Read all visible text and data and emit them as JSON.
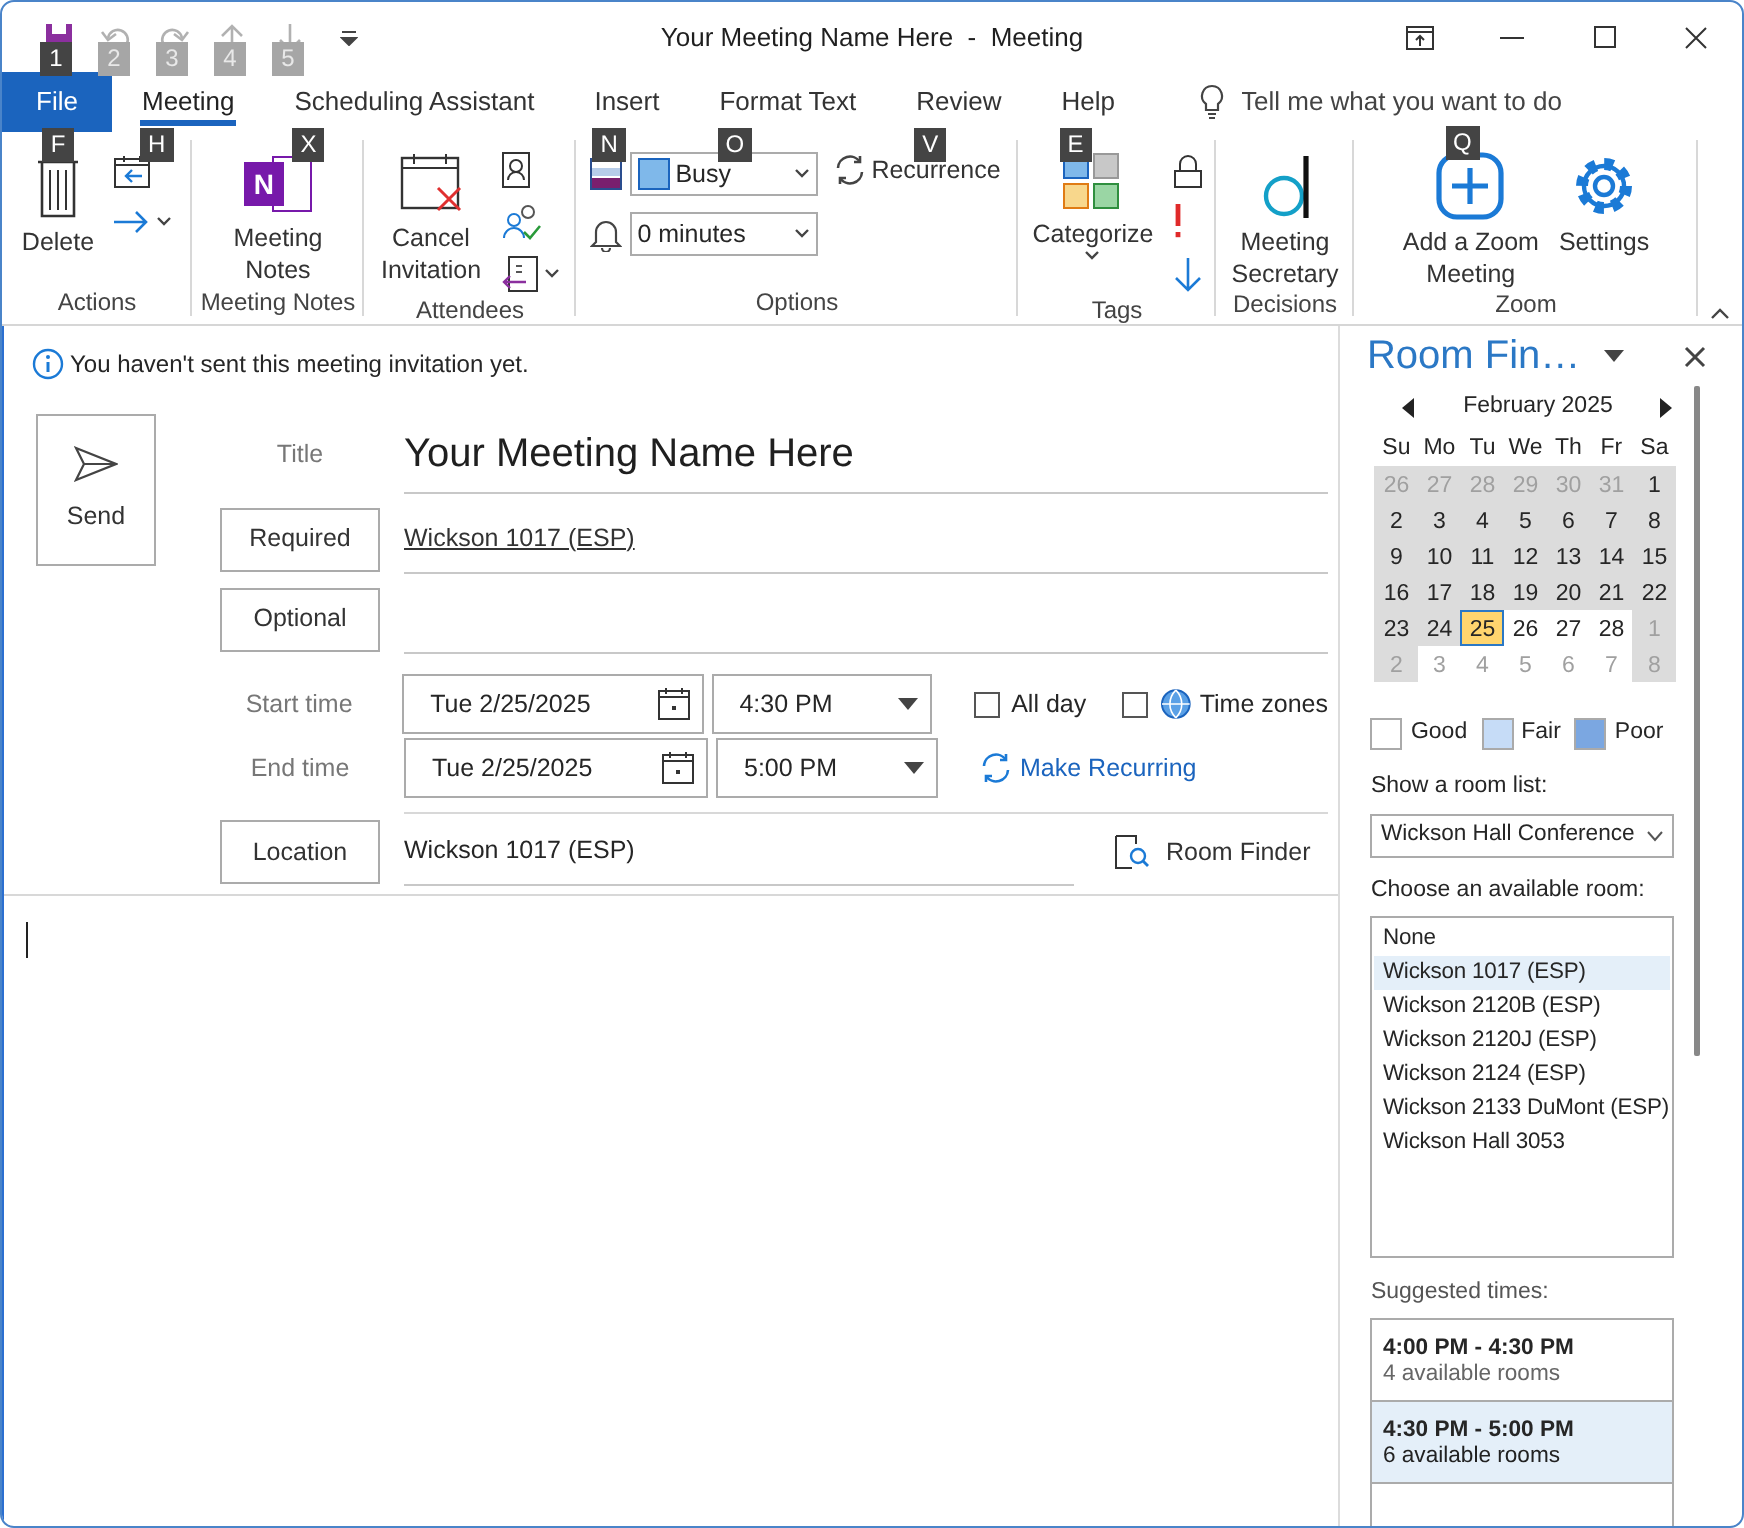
{
  "window": {
    "title": "Your Meeting Name Here  -  Meeting"
  },
  "quick_access": [
    {
      "keytip": "1",
      "disabled": false
    },
    {
      "keytip": "2",
      "disabled": true
    },
    {
      "keytip": "3",
      "disabled": true
    },
    {
      "keytip": "4",
      "disabled": true
    },
    {
      "keytip": "5",
      "disabled": true
    }
  ],
  "tabs": [
    {
      "label": "File",
      "keytip": "F",
      "kind": "file",
      "selected": false
    },
    {
      "label": "Meeting",
      "keytip": "H",
      "kind": "tab",
      "selected": true
    },
    {
      "label": "Scheduling Assistant",
      "keytip": "X",
      "kind": "tab",
      "selected": false
    },
    {
      "label": "Insert",
      "keytip": "N",
      "kind": "tab",
      "selected": false
    },
    {
      "label": "Format Text",
      "keytip": "O",
      "kind": "tab",
      "selected": false
    },
    {
      "label": "Review",
      "keytip": "V",
      "kind": "tab",
      "selected": false
    },
    {
      "label": "Help",
      "keytip": "E",
      "kind": "tab",
      "selected": false
    }
  ],
  "tell_me": {
    "placeholder": "Tell me what you want to do",
    "keytip": "Q"
  },
  "ribbon": {
    "groups": [
      {
        "label": "Actions",
        "commands": [
          {
            "kind": "large",
            "label": "Delete"
          },
          {
            "kind": "small"
          },
          {
            "kind": "small"
          }
        ]
      },
      {
        "label": "Meeting Notes",
        "commands": [
          {
            "kind": "large",
            "label": "Meeting\nNotes",
            "icon_text": "N"
          }
        ]
      },
      {
        "label": "Attendees",
        "commands": [
          {
            "kind": "large",
            "label": "Cancel\nInvitation"
          },
          {
            "kind": "small"
          },
          {
            "kind": "small"
          },
          {
            "kind": "small"
          }
        ]
      },
      {
        "label": "Options",
        "commands": [
          {
            "kind": "select",
            "value": "Busy"
          },
          {
            "kind": "select",
            "value": "0 minutes"
          },
          {
            "kind": "small",
            "label": "Recurrence"
          }
        ]
      },
      {
        "label": "Tags",
        "commands": [
          {
            "kind": "large",
            "label": "Categorize"
          },
          {
            "kind": "small"
          },
          {
            "kind": "small"
          },
          {
            "kind": "small"
          }
        ]
      },
      {
        "label": "Decisions",
        "commands": [
          {
            "kind": "large",
            "label": "Meeting\nSecretary"
          }
        ]
      },
      {
        "label": "Zoom",
        "commands": [
          {
            "kind": "large",
            "label": "Add a Zoom\nMeeting"
          },
          {
            "kind": "large",
            "label": "Settings"
          }
        ]
      }
    ]
  },
  "info_bar": {
    "text": "You haven't sent this meeting invitation yet."
  },
  "send": {
    "label": "Send"
  },
  "form": {
    "title": {
      "label": "Title",
      "value": "Your Meeting Name Here"
    },
    "required": {
      "label": "Required",
      "value": "Wickson 1017 (ESP)"
    },
    "optional": {
      "label": "Optional"
    },
    "start": {
      "label": "Start time",
      "date": "Tue 2/25/2025",
      "time": "4:30 PM"
    },
    "end": {
      "label": "End time",
      "date": "Tue 2/25/2025",
      "time": "5:00 PM"
    },
    "all_day": {
      "label": "All day",
      "checked": false
    },
    "time_zones": {
      "label": "Time zones",
      "checked": false
    },
    "make_recurring": "Make Recurring",
    "location": {
      "label": "Location",
      "value": "Wickson 1017 (ESP)"
    },
    "room_finder": "Room Finder"
  },
  "room_finder_pane": {
    "title": "Room Fin…",
    "month": "February 2025",
    "weekdays": [
      "Su",
      "Mo",
      "Tu",
      "We",
      "Th",
      "Fr",
      "Sa"
    ],
    "weeks": [
      [
        {
          "day": "26",
          "other_month": true,
          "shaded": true,
          "selected": false
        },
        {
          "day": "27",
          "other_month": true,
          "shaded": true,
          "selected": false
        },
        {
          "day": "28",
          "other_month": true,
          "shaded": true,
          "selected": false
        },
        {
          "day": "29",
          "other_month": true,
          "shaded": true,
          "selected": false
        },
        {
          "day": "30",
          "other_month": true,
          "shaded": true,
          "selected": false
        },
        {
          "day": "31",
          "other_month": true,
          "shaded": true,
          "selected": false
        },
        {
          "day": "1",
          "other_month": false,
          "shaded": true,
          "selected": false
        }
      ],
      [
        {
          "day": "2",
          "other_month": false,
          "shaded": true,
          "selected": false
        },
        {
          "day": "3",
          "other_month": false,
          "shaded": true,
          "selected": false
        },
        {
          "day": "4",
          "other_month": false,
          "shaded": true,
          "selected": false
        },
        {
          "day": "5",
          "other_month": false,
          "shaded": true,
          "selected": false
        },
        {
          "day": "6",
          "other_month": false,
          "shaded": true,
          "selected": false
        },
        {
          "day": "7",
          "other_month": false,
          "shaded": true,
          "selected": false
        },
        {
          "day": "8",
          "other_month": false,
          "shaded": true,
          "selected": false
        }
      ],
      [
        {
          "day": "9",
          "other_month": false,
          "shaded": true,
          "selected": false
        },
        {
          "day": "10",
          "other_month": false,
          "shaded": true,
          "selected": false
        },
        {
          "day": "11",
          "other_month": false,
          "shaded": true,
          "selected": false
        },
        {
          "day": "12",
          "other_month": false,
          "shaded": true,
          "selected": false
        },
        {
          "day": "13",
          "other_month": false,
          "shaded": true,
          "selected": false
        },
        {
          "day": "14",
          "other_month": false,
          "shaded": true,
          "selected": false
        },
        {
          "day": "15",
          "other_month": false,
          "shaded": true,
          "selected": false
        }
      ],
      [
        {
          "day": "16",
          "other_month": false,
          "shaded": true,
          "selected": false
        },
        {
          "day": "17",
          "other_month": false,
          "shaded": true,
          "selected": false
        },
        {
          "day": "18",
          "other_month": false,
          "shaded": true,
          "selected": false
        },
        {
          "day": "19",
          "other_month": false,
          "shaded": true,
          "selected": false
        },
        {
          "day": "20",
          "other_month": false,
          "shaded": true,
          "selected": false
        },
        {
          "day": "21",
          "other_month": false,
          "shaded": true,
          "selected": false
        },
        {
          "day": "22",
          "other_month": false,
          "shaded": true,
          "selected": false
        }
      ],
      [
        {
          "day": "23",
          "other_month": false,
          "shaded": true,
          "selected": false
        },
        {
          "day": "24",
          "other_month": false,
          "shaded": true,
          "selected": false
        },
        {
          "day": "25",
          "other_month": false,
          "shaded": false,
          "selected": true
        },
        {
          "day": "26",
          "other_month": false,
          "shaded": false,
          "selected": false
        },
        {
          "day": "27",
          "other_month": false,
          "shaded": false,
          "selected": false
        },
        {
          "day": "28",
          "other_month": false,
          "shaded": false,
          "selected": false
        },
        {
          "day": "1",
          "other_month": true,
          "shaded": true,
          "selected": false
        }
      ],
      [
        {
          "day": "2",
          "other_month": true,
          "shaded": true,
          "selected": false
        },
        {
          "day": "3",
          "other_month": true,
          "shaded": false,
          "selected": false
        },
        {
          "day": "4",
          "other_month": true,
          "shaded": false,
          "selected": false
        },
        {
          "day": "5",
          "other_month": true,
          "shaded": false,
          "selected": false
        },
        {
          "day": "6",
          "other_month": true,
          "shaded": false,
          "selected": false
        },
        {
          "day": "7",
          "other_month": true,
          "shaded": false,
          "selected": false
        },
        {
          "day": "8",
          "other_month": true,
          "shaded": true,
          "selected": false
        }
      ]
    ],
    "legend": [
      {
        "label": "Good",
        "color": "#ffffff"
      },
      {
        "label": "Fair",
        "color": "#c6dcf7"
      },
      {
        "label": "Poor",
        "color": "#7ba7e1"
      }
    ],
    "room_list_label": "Show a room list:",
    "room_list_value": "Wickson Hall Conference",
    "rooms_label": "Choose an available room:",
    "rooms": [
      {
        "name": "None",
        "selected": false
      },
      {
        "name": "Wickson 1017 (ESP)",
        "selected": true
      },
      {
        "name": "Wickson 2120B (ESP)",
        "selected": false
      },
      {
        "name": "Wickson 2120J (ESP)",
        "selected": false
      },
      {
        "name": "Wickson 2124 (ESP)",
        "selected": false
      },
      {
        "name": "Wickson 2133 DuMont (ESP)",
        "selected": false
      },
      {
        "name": "Wickson Hall 3053",
        "selected": false
      }
    ],
    "suggested_label": "Suggested times:",
    "suggested": [
      {
        "time": "4:00 PM - 4:30 PM",
        "rooms": "4 available rooms",
        "selected": false
      },
      {
        "time": "4:30 PM - 5:00 PM",
        "rooms": "6 available rooms",
        "selected": true
      }
    ]
  }
}
